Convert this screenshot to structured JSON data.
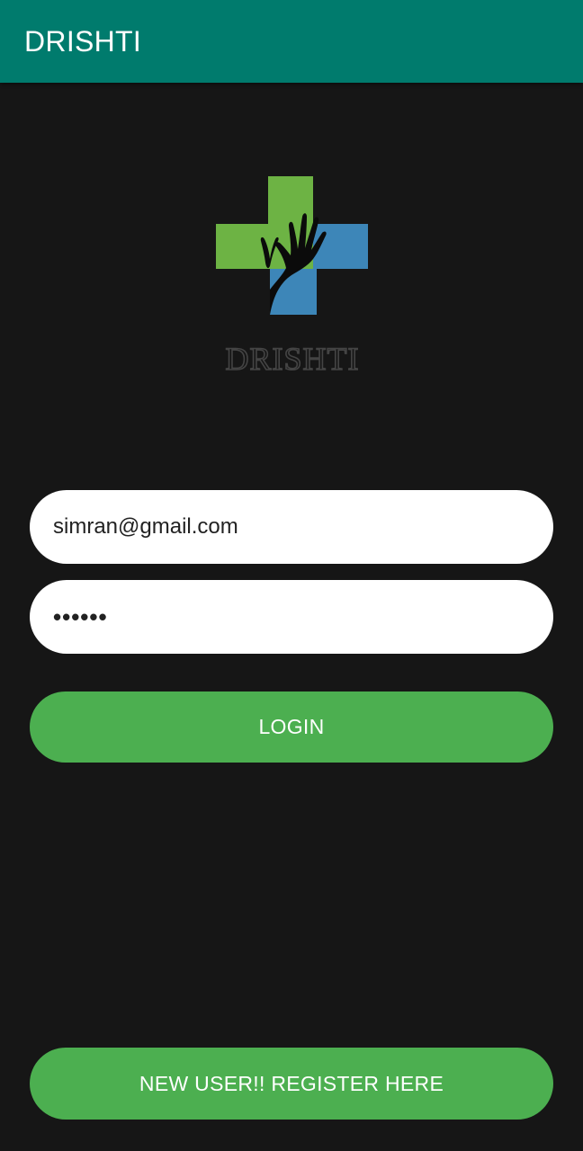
{
  "app_bar": {
    "title": "DRISHTI",
    "background": "#007b6d"
  },
  "logo": {
    "wordmark": "DRISHTI",
    "colors": {
      "green": "#6db344",
      "blue": "#3d86b8",
      "hand": "#0b0b0b",
      "wordmark": "#3a3a3a"
    }
  },
  "form": {
    "email": {
      "value": "simran@gmail.com",
      "placeholder": ""
    },
    "password": {
      "value": "••••••",
      "placeholder": ""
    },
    "login_label": "LOGIN"
  },
  "footer": {
    "register_label": "NEW USER!! REGISTER HERE"
  },
  "theme": {
    "background": "#161616",
    "accent": "#4caf50",
    "text_on_accent": "#ffffff"
  }
}
